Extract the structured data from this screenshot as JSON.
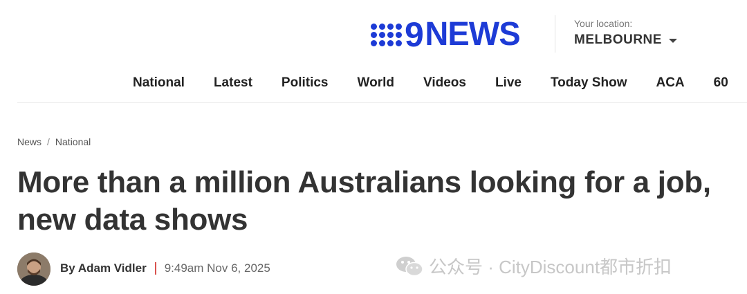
{
  "header": {
    "logo_text_nine": "9",
    "logo_text_news": "NEWS",
    "location_label": "Your location:",
    "location_value": "MELBOURNE"
  },
  "nav": {
    "items": [
      "National",
      "Latest",
      "Politics",
      "World",
      "Videos",
      "Live",
      "Today Show",
      "ACA",
      "60"
    ]
  },
  "breadcrumb": {
    "items": [
      "News",
      "National"
    ],
    "separator": "/"
  },
  "article": {
    "headline_line1": "More than a million Australians looking for a job,",
    "headline_line2": "new data shows",
    "author": "By Adam Vidler",
    "published": "9:49am Nov 6, 2025"
  },
  "watermark": {
    "text": "公众号 · CityDiscount都市折扣"
  },
  "icons": {
    "logo": "nine-dots-icon",
    "location_caret": "chevron-down-icon",
    "watermark": "wechat-icon"
  },
  "colors": {
    "brand_blue": "#1d3bd6",
    "text_dark": "#333333",
    "divider_red": "#d9534f"
  }
}
